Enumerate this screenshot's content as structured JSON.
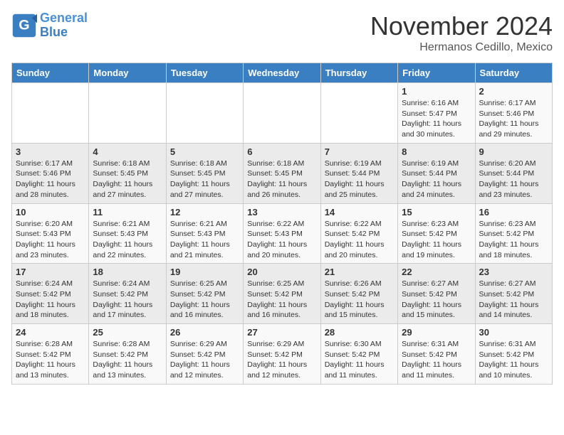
{
  "header": {
    "logo_line1": "General",
    "logo_line2": "Blue",
    "month": "November 2024",
    "location": "Hermanos Cedillo, Mexico"
  },
  "weekdays": [
    "Sunday",
    "Monday",
    "Tuesday",
    "Wednesday",
    "Thursday",
    "Friday",
    "Saturday"
  ],
  "weeks": [
    [
      {
        "day": "",
        "info": ""
      },
      {
        "day": "",
        "info": ""
      },
      {
        "day": "",
        "info": ""
      },
      {
        "day": "",
        "info": ""
      },
      {
        "day": "",
        "info": ""
      },
      {
        "day": "1",
        "info": "Sunrise: 6:16 AM\nSunset: 5:47 PM\nDaylight: 11 hours and 30 minutes."
      },
      {
        "day": "2",
        "info": "Sunrise: 6:17 AM\nSunset: 5:46 PM\nDaylight: 11 hours and 29 minutes."
      }
    ],
    [
      {
        "day": "3",
        "info": "Sunrise: 6:17 AM\nSunset: 5:46 PM\nDaylight: 11 hours and 28 minutes."
      },
      {
        "day": "4",
        "info": "Sunrise: 6:18 AM\nSunset: 5:45 PM\nDaylight: 11 hours and 27 minutes."
      },
      {
        "day": "5",
        "info": "Sunrise: 6:18 AM\nSunset: 5:45 PM\nDaylight: 11 hours and 27 minutes."
      },
      {
        "day": "6",
        "info": "Sunrise: 6:18 AM\nSunset: 5:45 PM\nDaylight: 11 hours and 26 minutes."
      },
      {
        "day": "7",
        "info": "Sunrise: 6:19 AM\nSunset: 5:44 PM\nDaylight: 11 hours and 25 minutes."
      },
      {
        "day": "8",
        "info": "Sunrise: 6:19 AM\nSunset: 5:44 PM\nDaylight: 11 hours and 24 minutes."
      },
      {
        "day": "9",
        "info": "Sunrise: 6:20 AM\nSunset: 5:44 PM\nDaylight: 11 hours and 23 minutes."
      }
    ],
    [
      {
        "day": "10",
        "info": "Sunrise: 6:20 AM\nSunset: 5:43 PM\nDaylight: 11 hours and 23 minutes."
      },
      {
        "day": "11",
        "info": "Sunrise: 6:21 AM\nSunset: 5:43 PM\nDaylight: 11 hours and 22 minutes."
      },
      {
        "day": "12",
        "info": "Sunrise: 6:21 AM\nSunset: 5:43 PM\nDaylight: 11 hours and 21 minutes."
      },
      {
        "day": "13",
        "info": "Sunrise: 6:22 AM\nSunset: 5:43 PM\nDaylight: 11 hours and 20 minutes."
      },
      {
        "day": "14",
        "info": "Sunrise: 6:22 AM\nSunset: 5:42 PM\nDaylight: 11 hours and 20 minutes."
      },
      {
        "day": "15",
        "info": "Sunrise: 6:23 AM\nSunset: 5:42 PM\nDaylight: 11 hours and 19 minutes."
      },
      {
        "day": "16",
        "info": "Sunrise: 6:23 AM\nSunset: 5:42 PM\nDaylight: 11 hours and 18 minutes."
      }
    ],
    [
      {
        "day": "17",
        "info": "Sunrise: 6:24 AM\nSunset: 5:42 PM\nDaylight: 11 hours and 18 minutes."
      },
      {
        "day": "18",
        "info": "Sunrise: 6:24 AM\nSunset: 5:42 PM\nDaylight: 11 hours and 17 minutes."
      },
      {
        "day": "19",
        "info": "Sunrise: 6:25 AM\nSunset: 5:42 PM\nDaylight: 11 hours and 16 minutes."
      },
      {
        "day": "20",
        "info": "Sunrise: 6:25 AM\nSunset: 5:42 PM\nDaylight: 11 hours and 16 minutes."
      },
      {
        "day": "21",
        "info": "Sunrise: 6:26 AM\nSunset: 5:42 PM\nDaylight: 11 hours and 15 minutes."
      },
      {
        "day": "22",
        "info": "Sunrise: 6:27 AM\nSunset: 5:42 PM\nDaylight: 11 hours and 15 minutes."
      },
      {
        "day": "23",
        "info": "Sunrise: 6:27 AM\nSunset: 5:42 PM\nDaylight: 11 hours and 14 minutes."
      }
    ],
    [
      {
        "day": "24",
        "info": "Sunrise: 6:28 AM\nSunset: 5:42 PM\nDaylight: 11 hours and 13 minutes."
      },
      {
        "day": "25",
        "info": "Sunrise: 6:28 AM\nSunset: 5:42 PM\nDaylight: 11 hours and 13 minutes."
      },
      {
        "day": "26",
        "info": "Sunrise: 6:29 AM\nSunset: 5:42 PM\nDaylight: 11 hours and 12 minutes."
      },
      {
        "day": "27",
        "info": "Sunrise: 6:29 AM\nSunset: 5:42 PM\nDaylight: 11 hours and 12 minutes."
      },
      {
        "day": "28",
        "info": "Sunrise: 6:30 AM\nSunset: 5:42 PM\nDaylight: 11 hours and 11 minutes."
      },
      {
        "day": "29",
        "info": "Sunrise: 6:31 AM\nSunset: 5:42 PM\nDaylight: 11 hours and 11 minutes."
      },
      {
        "day": "30",
        "info": "Sunrise: 6:31 AM\nSunset: 5:42 PM\nDaylight: 11 hours and 10 minutes."
      }
    ]
  ]
}
